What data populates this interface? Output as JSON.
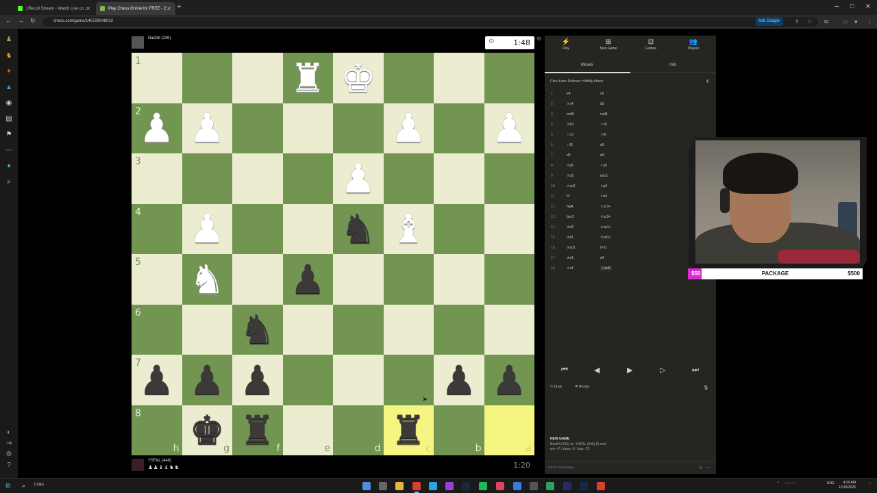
{
  "browser": {
    "tabs": [
      {
        "title": "1Recoil Stream - Watch Live on...",
        "active": false
      },
      {
        "title": "Play Chess Online for FREE - 2...",
        "active": true
      }
    ],
    "new_tab_label": "+",
    "url": "chess.com/game/146729048032",
    "ask_google_label": "Ask Google"
  },
  "game": {
    "top_player": {
      "name": "lilachill (236)",
      "captured": ""
    },
    "bottom_player": {
      "name": "YSFAL (446)",
      "captured": "♟♟♝♝♞♞"
    },
    "top_clock": "1:48",
    "bottom_clock": "1:20",
    "ranks_shown": [
      "1",
      "2",
      "3",
      "4",
      "5",
      "6",
      "7",
      "8"
    ],
    "files_shown": [
      "h",
      "g",
      "f",
      "e",
      "d",
      "c",
      "b",
      "a"
    ],
    "board": [
      [
        "",
        "",
        "",
        "wR",
        "wK",
        "",
        "",
        ""
      ],
      [
        "wP",
        "wP",
        "",
        "",
        "",
        "wP",
        "",
        "wP"
      ],
      [
        "",
        "",
        "",
        "",
        "wP",
        "",
        "",
        ""
      ],
      [
        "",
        "wP",
        "",
        "",
        "bN",
        "wB",
        "",
        ""
      ],
      [
        "",
        "wN",
        "",
        "bP",
        "",
        "",
        "",
        ""
      ],
      [
        "",
        "",
        "bN",
        "",
        "",
        "",
        "",
        ""
      ],
      [
        "bP",
        "bP",
        "bP",
        "",
        "",
        "",
        "bP",
        "bP"
      ],
      [
        "",
        "bK",
        "bR",
        "",
        "",
        "bR",
        "",
        ""
      ]
    ],
    "highlighted_squares": [
      [
        7,
        5
      ],
      [
        7,
        7
      ]
    ]
  },
  "panel": {
    "tabs": [
      {
        "label": "Play",
        "icon": "⚡"
      },
      {
        "label": "New Game",
        "icon": "⊞"
      },
      {
        "label": "Games",
        "icon": "⊡"
      },
      {
        "label": "Players",
        "icon": "👥"
      }
    ],
    "subtabs": {
      "moves": "Moves",
      "info": "Info"
    },
    "opening": "Caro-Kann Defense: Hillbilly Attack",
    "moves": [
      {
        "n": "1.",
        "w": "e4",
        "b": "c6"
      },
      {
        "n": "2.",
        "w": "♗c4",
        "b": "d5"
      },
      {
        "n": "3.",
        "w": "exd5",
        "b": "cxd5"
      },
      {
        "n": "4.",
        "w": "♗b3",
        "b": "♘c6"
      },
      {
        "n": "5.",
        "w": "♘c3",
        "b": "♘f6"
      },
      {
        "n": "6.",
        "w": "♘f3",
        "b": "e5"
      },
      {
        "n": "7.",
        "w": "d3",
        "b": "d4"
      },
      {
        "n": "8.",
        "w": "♗g5",
        "b": "♗a5"
      },
      {
        "n": "9.",
        "w": "♗d2",
        "b": "dxc3"
      },
      {
        "n": "10.",
        "w": "♗xc3",
        "b": "♗g4"
      },
      {
        "n": "11.",
        "w": "f3",
        "b": "♗b4"
      },
      {
        "n": "12.",
        "w": "fxg4",
        "b": "♗xc3+"
      },
      {
        "n": "13.",
        "w": "bxc3",
        "b": "♕xc3+"
      },
      {
        "n": "14.",
        "w": "♔d2",
        "b": "♕xa1+"
      },
      {
        "n": "15.",
        "w": "♔d1",
        "b": "♕xd1+"
      },
      {
        "n": "16.",
        "w": "♔xd1",
        "b": "O-O"
      },
      {
        "n": "17.",
        "w": "♔e1",
        "b": "d4"
      },
      {
        "n": "18.",
        "w": "♗c4",
        "b": "♖ac8"
      }
    ],
    "actions": {
      "draw": "Draw",
      "resign": "Resign"
    },
    "new_game": {
      "title": "NEW GAME",
      "line1": "lilachill (236) vs. YSFAL (446) (5 min)",
      "line2": "win +7 / draw -8 / lose -22"
    },
    "chat_placeholder": "Send a message..."
  },
  "overlay": {
    "goal_left": "$50",
    "goal_center": "PACKAGE",
    "goal_right": "$500",
    "goal_progress": 0.08
  },
  "taskbar": {
    "search_label": "Links",
    "lang": "ENG",
    "time": "4:20 AM",
    "date": "12/15/2025"
  },
  "colors": {
    "light_square": "#ebecd0",
    "dark_square": "#739552",
    "highlight": "#f5f682",
    "goal_accent": "#d82cd0"
  }
}
